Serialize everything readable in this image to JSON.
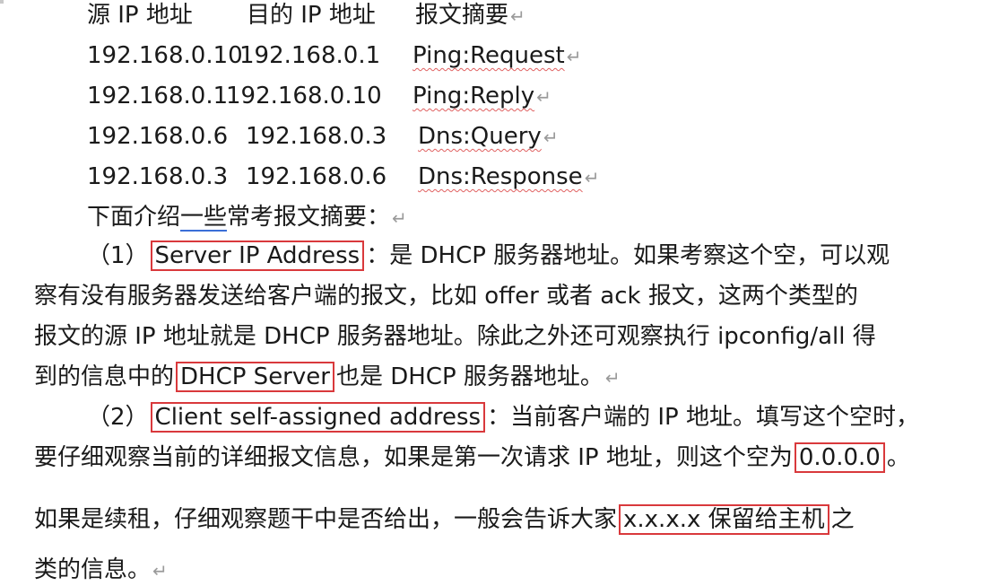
{
  "table": {
    "headers": [
      "源 IP 地址",
      "目的 IP 地址",
      "报文摘要"
    ],
    "rows": [
      [
        "192.168.0.10",
        "192.168.0.1",
        "Ping:Request"
      ],
      [
        "192.168.0.1",
        "192.168.0.10",
        "Ping:Reply"
      ],
      [
        "192.168.0.6",
        "192.168.0.3",
        "Dns:Query"
      ],
      [
        "192.168.0.3",
        "192.168.0.6",
        "Dns:Response"
      ]
    ]
  },
  "return_mark": "↵",
  "intro": {
    "pre": "下面介绍",
    "underlined": "一些",
    "post": "常考报文摘要："
  },
  "item1": {
    "num": "（1）",
    "term": "Server IP Address",
    "line1_rest": "：是 DHCP 服务器地址。如果考察这个空，可以观",
    "line2": "察有没有服务器发送给客户端的报文，比如 offer 或者 ack 报文，这两个类型的",
    "line3": "报文的源 IP 地址就是 DHCP 服务器地址。除此之外还可观察执行 ipconfig/all 得",
    "line4_pre": "到的信息中的",
    "line4_term": "DHCP Server",
    "line4_post": "也是 DHCP 服务器地址。"
  },
  "item2": {
    "num": "（2）",
    "term": "Client self-assigned address",
    "line1_rest": "：当前客户端的 IP 地址。填写这个空时，",
    "line2_pre": "要仔细观察当前的详细报文信息，如果是第一次请求 IP 地址，则这个空为",
    "line2_term": "0.0.0.0",
    "line2_post": "。",
    "line3_pre": "如果是续租，仔细观察题干中是否给出，一般会告诉大家",
    "line3_term": "x.x.x.x 保留给主机",
    "line3_post": "之",
    "line4": "类的信息。"
  }
}
